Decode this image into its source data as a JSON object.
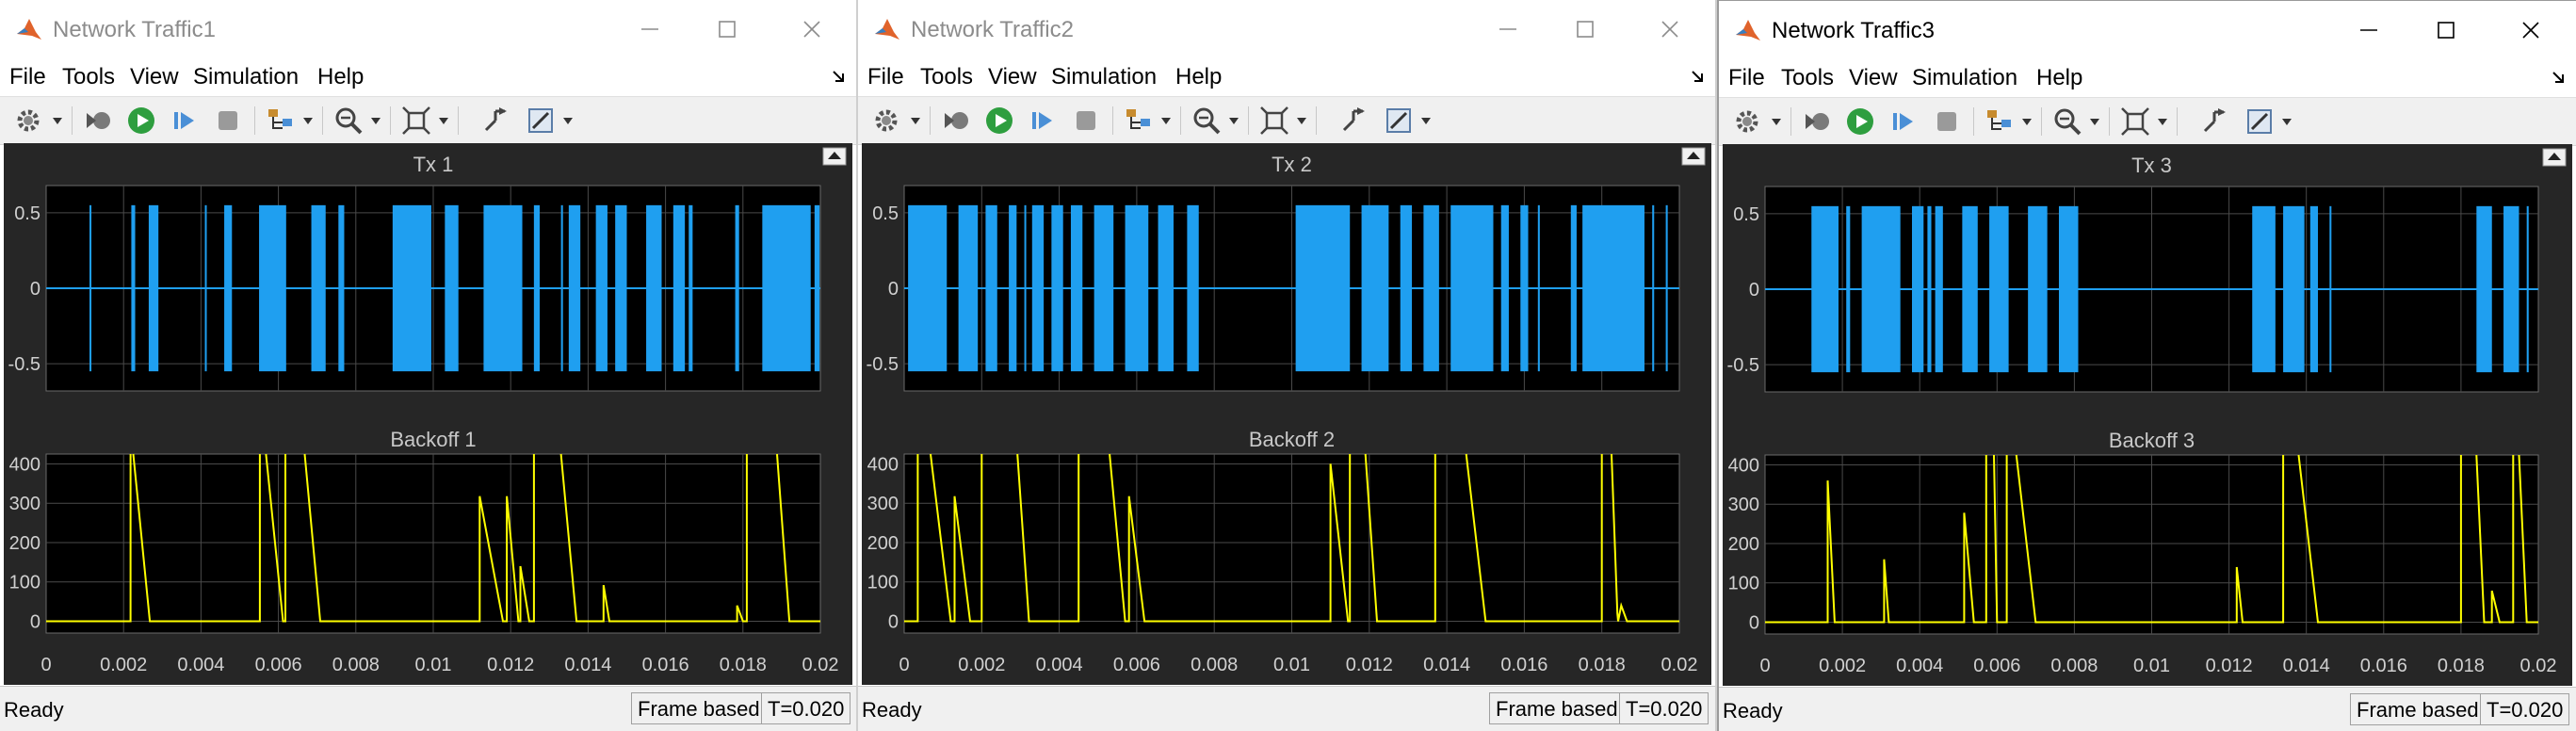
{
  "menu": [
    "File",
    "Tools",
    "View",
    "Simulation",
    "Help"
  ],
  "icons": {
    "app": "matlab-logo-icon",
    "toolbar": [
      "configuration-gear-icon",
      "step-back-icon",
      "run-icon",
      "step-forward-icon",
      "stop-icon",
      "signal-select-icon",
      "zoom-icon",
      "fit-axes-icon",
      "scale-axes-icon",
      "draw-style-icon"
    ],
    "undock": "undock-icon",
    "window_controls": [
      "minimize-icon",
      "maximize-icon",
      "close-icon"
    ]
  },
  "colors": {
    "scope_bg": "#262626",
    "axes_bg": "#000000",
    "tx_trace": "#1f9ff0",
    "backoff_trace": "#ffff00",
    "grid": "#4a4a4a",
    "tick_text": "#d0d0d0"
  },
  "windows": [
    {
      "title": "Network Traffic1",
      "active": false,
      "status": {
        "text": "Ready",
        "frame": "Frame based",
        "time": "T=0.020"
      },
      "tx": {
        "title": "Tx 1",
        "yticks": [
          "0.5",
          "0",
          "-0.5"
        ],
        "bursts": [
          [
            0.00112,
            0.00114
          ],
          [
            0.0022,
            0.0023
          ],
          [
            0.00265,
            0.0029
          ],
          [
            0.0041,
            0.00412
          ],
          [
            0.0046,
            0.0048
          ],
          [
            0.0055,
            0.0062
          ],
          [
            0.00685,
            0.00722
          ],
          [
            0.00755,
            0.0077
          ],
          [
            0.00895,
            0.00995
          ],
          [
            0.0103,
            0.01065
          ],
          [
            0.0113,
            0.0123
          ],
          [
            0.0126,
            0.01275
          ],
          [
            0.0133,
            0.01335
          ],
          [
            0.0135,
            0.0138
          ],
          [
            0.0142,
            0.0145
          ],
          [
            0.0147,
            0.015
          ],
          [
            0.0155,
            0.0159
          ],
          [
            0.0162,
            0.0165
          ],
          [
            0.0166,
            0.0167
          ],
          [
            0.0178,
            0.0179
          ],
          [
            0.0185,
            0.01975
          ],
          [
            0.01985,
            0.01998
          ]
        ]
      },
      "backoff": {
        "title": "Backoff 1",
        "yticks": [
          "400",
          "300",
          "200",
          "100",
          "0"
        ],
        "xticks": [
          "0",
          "0.002",
          "0.004",
          "0.006",
          "0.008",
          "0.01",
          "0.012",
          "0.014",
          "0.016",
          "0.018",
          "0.02"
        ],
        "ylim": [
          -30,
          425
        ],
        "xlim": [
          0,
          0.02
        ],
        "segments": [
          [
            [
              0,
              0
            ],
            [
              0.00218,
              0
            ],
            [
              0.00218,
              425
            ]
          ],
          [
            [
              0.00225,
              425
            ],
            [
              0.00268,
              0
            ],
            [
              0.00552,
              0
            ],
            [
              0.00552,
              425
            ]
          ],
          [
            [
              0.00568,
              425
            ],
            [
              0.00612,
              0
            ],
            [
              0.00618,
              0
            ],
            [
              0.00618,
              425
            ]
          ],
          [
            [
              0.00668,
              425
            ],
            [
              0.00708,
              0
            ],
            [
              0.0112,
              0
            ],
            [
              0.0112,
              318
            ],
            [
              0.0118,
              0
            ],
            [
              0.0119,
              0
            ],
            [
              0.0119,
              318
            ],
            [
              0.0122,
              0
            ],
            [
              0.01225,
              0
            ],
            [
              0.01225,
              140
            ],
            [
              0.01248,
              0
            ],
            [
              0.0126,
              0
            ],
            [
              0.0126,
              425
            ]
          ],
          [
            [
              0.0133,
              425
            ],
            [
              0.0137,
              0
            ],
            [
              0.0144,
              0
            ],
            [
              0.0144,
              92
            ],
            [
              0.01455,
              0
            ],
            [
              0.01785,
              0
            ],
            [
              0.01785,
              40
            ],
            [
              0.018,
              0
            ],
            [
              0.0181,
              0
            ],
            [
              0.0181,
              425
            ]
          ],
          [
            [
              0.01888,
              425
            ],
            [
              0.0192,
              0
            ],
            [
              0.02,
              0
            ]
          ]
        ]
      }
    },
    {
      "title": "Network Traffic2",
      "active": false,
      "status": {
        "text": "Ready",
        "frame": "Frame based",
        "time": "T=0.020"
      },
      "tx": {
        "title": "Tx 2",
        "yticks": [
          "0.5",
          "0",
          "-0.5"
        ],
        "bursts": [
          [
            0.0001,
            0.0011
          ],
          [
            0.0014,
            0.0019
          ],
          [
            0.0021,
            0.0024
          ],
          [
            0.0027,
            0.0029
          ],
          [
            0.0031,
            0.00312
          ],
          [
            0.0033,
            0.0036
          ],
          [
            0.0038,
            0.0041
          ],
          [
            0.0043,
            0.0046
          ],
          [
            0.0049,
            0.0054
          ],
          [
            0.0057,
            0.0063
          ],
          [
            0.00655,
            0.00695
          ],
          [
            0.0073,
            0.0076
          ],
          [
            0.0101,
            0.0115
          ],
          [
            0.0118,
            0.0125
          ],
          [
            0.0128,
            0.0131
          ],
          [
            0.0134,
            0.0138
          ],
          [
            0.0141,
            0.0152
          ],
          [
            0.0154,
            0.0156
          ],
          [
            0.0159,
            0.0161
          ],
          [
            0.01635,
            0.0164
          ],
          [
            0.0172,
            0.01735
          ],
          [
            0.0175,
            0.0191
          ],
          [
            0.0193,
            0.01935
          ],
          [
            0.01965,
            0.0197
          ]
        ]
      },
      "backoff": {
        "title": "Backoff 2",
        "yticks": [
          "400",
          "300",
          "200",
          "100",
          "0"
        ],
        "xticks": [
          "0",
          "0.002",
          "0.004",
          "0.006",
          "0.008",
          "0.01",
          "0.012",
          "0.014",
          "0.016",
          "0.018",
          "0.02"
        ],
        "ylim": [
          -30,
          425
        ],
        "xlim": [
          0,
          0.02
        ],
        "segments": [
          [
            [
              0,
              0
            ],
            [
              0.00035,
              0
            ],
            [
              0.00035,
              425
            ]
          ],
          [
            [
              0.00068,
              425
            ],
            [
              0.0012,
              0
            ],
            [
              0.0013,
              0
            ],
            [
              0.0013,
              318
            ],
            [
              0.0017,
              0
            ],
            [
              0.002,
              0
            ],
            [
              0.002,
              425
            ]
          ],
          [
            [
              0.00292,
              425
            ],
            [
              0.00322,
              0
            ],
            [
              0.0045,
              0
            ],
            [
              0.0045,
              425
            ]
          ],
          [
            [
              0.0053,
              425
            ],
            [
              0.0057,
              0
            ],
            [
              0.0058,
              0
            ],
            [
              0.0058,
              318
            ],
            [
              0.0062,
              0
            ],
            [
              0.011,
              0
            ],
            [
              0.011,
              400
            ],
            [
              0.01145,
              0
            ],
            [
              0.0115,
              0
            ],
            [
              0.0115,
              425
            ]
          ],
          [
            [
              0.0119,
              425
            ],
            [
              0.0122,
              0
            ],
            [
              0.0137,
              0
            ],
            [
              0.0137,
              425
            ]
          ],
          [
            [
              0.0145,
              425
            ],
            [
              0.015,
              0
            ],
            [
              0.018,
              0
            ],
            [
              0.018,
              425
            ]
          ],
          [
            [
              0.01825,
              425
            ],
            [
              0.0184,
              20
            ],
            [
              0.01842,
              0
            ],
            [
              0.0185,
              40
            ],
            [
              0.01865,
              0
            ],
            [
              0.02,
              0
            ]
          ]
        ]
      }
    },
    {
      "title": "Network Traffic3",
      "active": true,
      "status": {
        "text": "Ready",
        "frame": "Frame based",
        "time": "T=0.020"
      },
      "tx": {
        "title": "Tx 3",
        "yticks": [
          "0.5",
          "0",
          "-0.5"
        ],
        "bursts": [
          [
            0.0012,
            0.0019
          ],
          [
            0.0021,
            0.0022
          ],
          [
            0.0025,
            0.0035
          ],
          [
            0.0038,
            0.0041
          ],
          [
            0.0042,
            0.0043
          ],
          [
            0.0044,
            0.0046
          ],
          [
            0.0051,
            0.0055
          ],
          [
            0.0058,
            0.0063
          ],
          [
            0.0068,
            0.0073
          ],
          [
            0.0076,
            0.0081
          ],
          [
            0.0126,
            0.0132
          ],
          [
            0.0134,
            0.01395
          ],
          [
            0.0141,
            0.0143
          ],
          [
            0.0146,
            0.01462
          ],
          [
            0.0184,
            0.0188
          ],
          [
            0.0191,
            0.0195
          ],
          [
            0.0197,
            0.01975
          ]
        ]
      },
      "backoff": {
        "title": "Backoff 3",
        "yticks": [
          "400",
          "300",
          "200",
          "100",
          "0"
        ],
        "xticks": [
          "0",
          "0.002",
          "0.004",
          "0.006",
          "0.008",
          "0.01",
          "0.012",
          "0.014",
          "0.016",
          "0.018",
          "0.02"
        ],
        "ylim": [
          -30,
          425
        ],
        "xlim": [
          0,
          0.02
        ],
        "segments": [
          [
            [
              0,
              0
            ],
            [
              0.00162,
              0
            ],
            [
              0.00162,
              360
            ],
            [
              0.0018,
              0
            ],
            [
              0.00308,
              0
            ],
            [
              0.00308,
              160
            ],
            [
              0.0032,
              0
            ],
            [
              0.00515,
              0
            ],
            [
              0.00515,
              278
            ],
            [
              0.0054,
              0
            ],
            [
              0.00572,
              0
            ],
            [
              0.00572,
              425
            ]
          ],
          [
            [
              0.00592,
              425
            ],
            [
              0.006,
              0
            ],
            [
              0.00625,
              0
            ],
            [
              0.00625,
              425
            ]
          ],
          [
            [
              0.0065,
              425
            ],
            [
              0.007,
              0
            ],
            [
              0.0122,
              0
            ],
            [
              0.0122,
              140
            ],
            [
              0.01235,
              0
            ],
            [
              0.0134,
              0
            ],
            [
              0.0134,
              425
            ]
          ],
          [
            [
              0.0138,
              425
            ],
            [
              0.0143,
              0
            ],
            [
              0.018,
              0
            ],
            [
              0.018,
              425
            ]
          ],
          [
            [
              0.0184,
              425
            ],
            [
              0.0186,
              0
            ],
            [
              0.0188,
              0
            ],
            [
              0.0188,
              80
            ],
            [
              0.019,
              0
            ],
            [
              0.01935,
              0
            ],
            [
              0.01935,
              425
            ]
          ],
          [
            [
              0.0195,
              425
            ],
            [
              0.0197,
              0
            ],
            [
              0.02,
              0
            ]
          ]
        ]
      }
    }
  ]
}
